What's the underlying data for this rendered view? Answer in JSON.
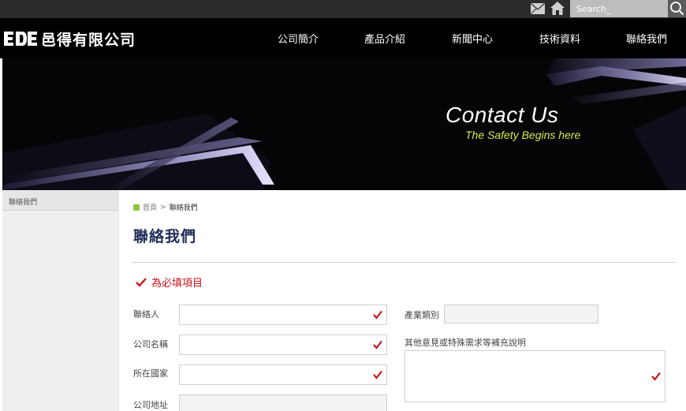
{
  "topbar": {
    "icons": [
      "mail-icon",
      "home-icon",
      "search-icon"
    ],
    "search_placeholder": "Search_"
  },
  "header": {
    "logo_text": "邑得有限公司",
    "nav": [
      "公司簡介",
      "產品介紹",
      "新聞中心",
      "技術資料",
      "聯絡我們"
    ]
  },
  "banner": {
    "title": "Contact Us",
    "subtitle": "The Safety Begins here"
  },
  "sidebar": {
    "items": [
      "聯絡我們"
    ]
  },
  "breadcrumb": {
    "home": "首頁",
    "separator": ">",
    "current": "聯絡我們"
  },
  "page_title": "聯絡我們",
  "required_note": "為必填項目",
  "form": {
    "contact_label": "聯絡人",
    "company_label": "公司名稱",
    "country_label": "所在國家",
    "address_label": "公司地址",
    "industry_label": "產業類別",
    "comments_label": "其他意見或特殊需求等補充說明"
  },
  "colors": {
    "accent_red": "#c8171d",
    "title_navy": "#1f2a57",
    "banner_subtitle": "#d6e84a"
  }
}
